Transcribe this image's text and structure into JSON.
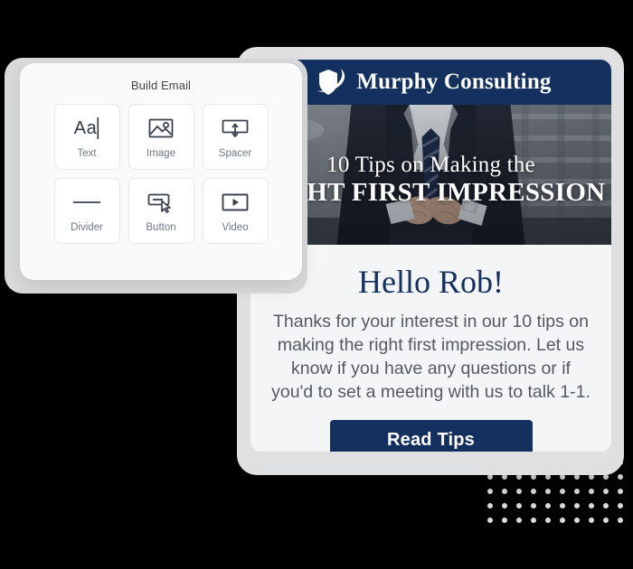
{
  "build_panel": {
    "title": "Build Email",
    "tiles": [
      {
        "label": "Text",
        "icon": "text-aa-icon",
        "glyph": "Aa"
      },
      {
        "label": "Image",
        "icon": "image-icon",
        "glyph": ""
      },
      {
        "label": "Spacer",
        "icon": "spacer-icon",
        "glyph": ""
      },
      {
        "label": "Divider",
        "icon": "divider-icon",
        "glyph": ""
      },
      {
        "label": "Button",
        "icon": "button-cursor-icon",
        "glyph": ""
      },
      {
        "label": "Video",
        "icon": "video-play-icon",
        "glyph": ""
      }
    ]
  },
  "email": {
    "brand_name": "Murphy Consulting",
    "logo_icon": "shield-swoosh-logo",
    "hero": {
      "line1": "10 Tips on Making the",
      "line2": "RIGHT FIRST IMPRESSION",
      "photo_alt": "businessman-in-suit-photo"
    },
    "greeting": "Hello Rob!",
    "body": "Thanks for your interest in our 10 tips on making the right first impression. Let us know if you have any questions or if you'd to set a meeting with us to talk 1-1.",
    "cta_label": "Read Tips"
  },
  "colors": {
    "brand_navy": "#14305e",
    "email_bg": "#f4f5f6",
    "device_frame": "#dfe0e2",
    "panel_bg": "#fafafa",
    "tile_border": "#e7e8ea",
    "label_gray": "#6e7887",
    "body_gray": "#555a60",
    "dot_gray": "#d8dade",
    "page_bg": "#000000"
  },
  "decoration": {
    "dot_grid": {
      "columns": 10,
      "rows": 5,
      "spacing": 16,
      "dot_size": 6
    }
  }
}
